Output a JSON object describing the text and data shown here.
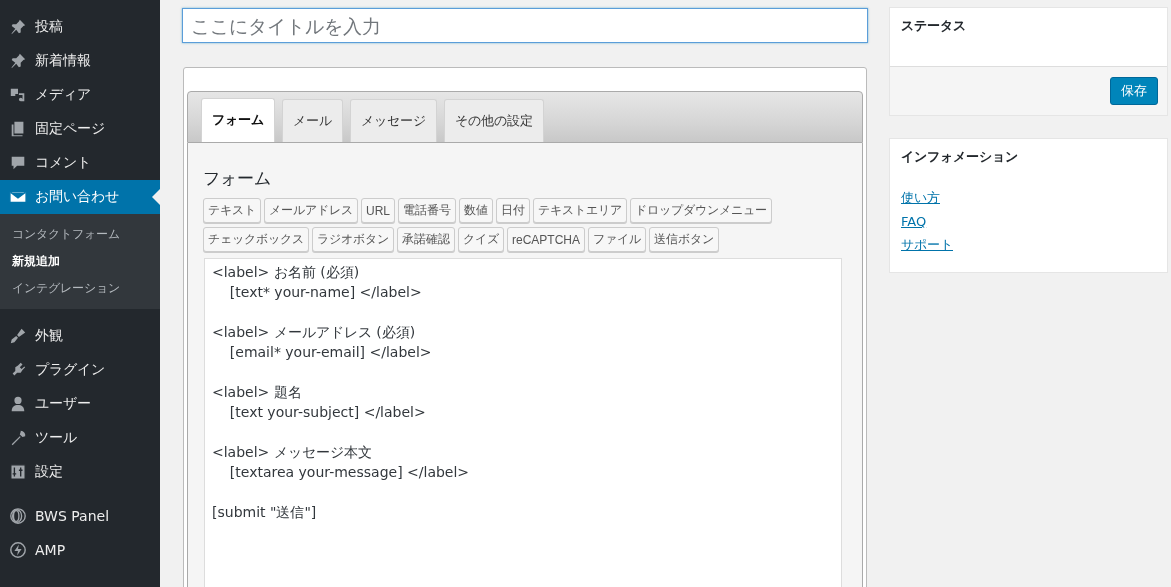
{
  "sidebar": {
    "items": [
      {
        "label": "投稿",
        "selected": false
      },
      {
        "label": "新着情報",
        "selected": false
      },
      {
        "label": "メディア",
        "selected": false
      },
      {
        "label": "固定ページ",
        "selected": false
      },
      {
        "label": "コメント",
        "selected": false
      },
      {
        "label": "お問い合わせ",
        "selected": true,
        "children": [
          {
            "label": "コンタクトフォーム",
            "selected": false
          },
          {
            "label": "新規追加",
            "selected": true
          },
          {
            "label": "インテグレーション",
            "selected": false
          }
        ]
      },
      {
        "label": "外観",
        "selected": false
      },
      {
        "label": "プラグイン",
        "selected": false
      },
      {
        "label": "ユーザー",
        "selected": false
      },
      {
        "label": "ツール",
        "selected": false
      },
      {
        "label": "設定",
        "selected": false
      },
      {
        "label": "BWS Panel",
        "selected": false
      },
      {
        "label": "AMP",
        "selected": false
      }
    ]
  },
  "title_field": {
    "placeholder": "ここにタイトルを入力"
  },
  "editor": {
    "tabs": [
      {
        "label": "フォーム",
        "selected": true
      },
      {
        "label": "メール",
        "selected": false
      },
      {
        "label": "メッセージ",
        "selected": false
      },
      {
        "label": "その他の設定",
        "selected": false
      }
    ],
    "heading": "フォーム",
    "tag_buttons": [
      "テキスト",
      "メールアドレス",
      "URL",
      "電話番号",
      "数値",
      "日付",
      "テキストエリア",
      "ドロップダウンメニュー",
      "チェックボックス",
      "ラジオボタン",
      "承諾確認",
      "クイズ",
      "reCAPTCHA",
      "ファイル",
      "送信ボタン"
    ],
    "form_code": "<label> お名前 (必須)\n    [text* your-name] </label>\n\n<label> メールアドレス (必須)\n    [email* your-email] </label>\n\n<label> 題名\n    [text your-subject] </label>\n\n<label> メッセージ本文\n    [textarea your-message] </label>\n\n[submit \"送信\"]"
  },
  "status_box": {
    "title": "ステータス",
    "save_button": "保存"
  },
  "info_box": {
    "title": "インフォメーション",
    "links": [
      "使い方",
      "FAQ",
      "サポート"
    ]
  }
}
